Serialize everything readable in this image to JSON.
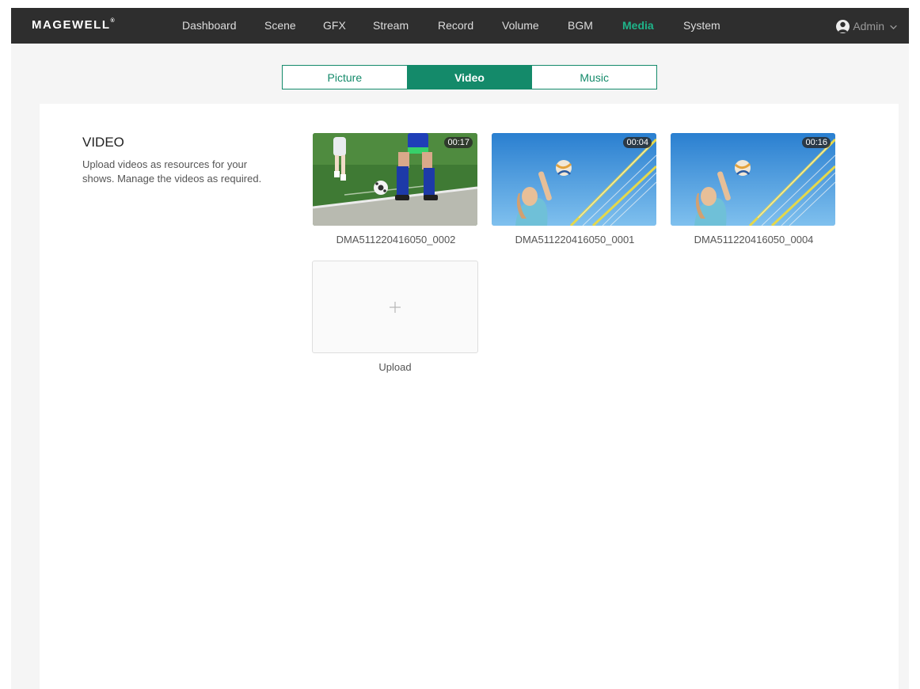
{
  "brand": {
    "logo_text": "MAGEWELL",
    "registered_mark": "®"
  },
  "nav": {
    "items": [
      {
        "label": "Dashboard",
        "active": false
      },
      {
        "label": "Scene",
        "active": false
      },
      {
        "label": "GFX",
        "active": false
      },
      {
        "label": "Stream",
        "active": false
      },
      {
        "label": "Record",
        "active": false
      },
      {
        "label": "Volume",
        "active": false
      },
      {
        "label": "BGM",
        "active": false
      },
      {
        "label": "Media",
        "active": true
      },
      {
        "label": "System",
        "active": false
      }
    ],
    "user": {
      "label": "Admin",
      "icon": "user-icon",
      "dropdown_icon": "chevron-down-icon"
    }
  },
  "tabs": [
    {
      "label": "Picture",
      "active": false
    },
    {
      "label": "Video",
      "active": true
    },
    {
      "label": "Music",
      "active": false
    }
  ],
  "section": {
    "title": "VIDEO",
    "description": "Upload videos as resources for your shows. Manage the videos as required."
  },
  "videos": [
    {
      "name": "DMA511220416050_0002",
      "duration": "00:17",
      "thumbnail": "soccer-players"
    },
    {
      "name": "DMA511220416050_0001",
      "duration": "00:04",
      "thumbnail": "volleyball-player"
    },
    {
      "name": "DMA511220416050_0004",
      "duration": "00:16",
      "thumbnail": "volleyball-player"
    }
  ],
  "upload": {
    "label": "Upload",
    "icon": "plus-icon"
  },
  "colors": {
    "accent": "#148a6a",
    "nav_active": "#1fb48a",
    "topbar": "#2e2e2e",
    "page_bg": "#f5f5f5"
  }
}
